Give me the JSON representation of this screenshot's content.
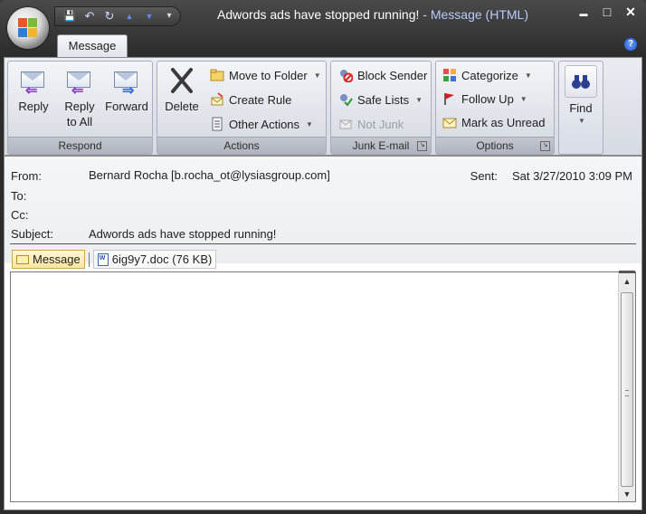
{
  "window": {
    "subject_title": "Adwords ads have stopped running!",
    "separator": " - ",
    "app_title": "Message (HTML)",
    "minimize": "▬",
    "maximize": "□",
    "close": "✕"
  },
  "qat": {
    "save": "💾",
    "undo": "↶",
    "redo": "↻",
    "up": "▲",
    "down": "▼",
    "more": "▾"
  },
  "tabs": {
    "message": "Message",
    "help": "?"
  },
  "ribbon": {
    "respond": {
      "label": "Respond",
      "reply": "Reply",
      "reply_all_1": "Reply",
      "reply_all_2": "to All",
      "forward": "Forward"
    },
    "actions": {
      "label": "Actions",
      "delete": "Delete",
      "move_to_folder": "Move to Folder",
      "create_rule": "Create Rule",
      "other_actions": "Other Actions"
    },
    "junk": {
      "label": "Junk E-mail",
      "block_sender": "Block Sender",
      "safe_lists": "Safe Lists",
      "not_junk": "Not Junk"
    },
    "options": {
      "label": "Options",
      "categorize": "Categorize",
      "follow_up": "Follow Up",
      "mark_unread": "Mark as Unread"
    },
    "find": {
      "label": "Find"
    }
  },
  "header": {
    "from_label": "From:",
    "from_value": "Bernard Rocha [b.rocha_ot@lysiasgroup.com]",
    "to_label": "To:",
    "cc_label": "Cc:",
    "subject_label": "Subject:",
    "subject_value": "Adwords ads have stopped running!",
    "sent_label": "Sent:",
    "sent_value": "Sat 3/27/2010 3:09 PM"
  },
  "attachments": {
    "message_tab": "Message",
    "file": "6ig9y7.doc (76 KB)"
  }
}
